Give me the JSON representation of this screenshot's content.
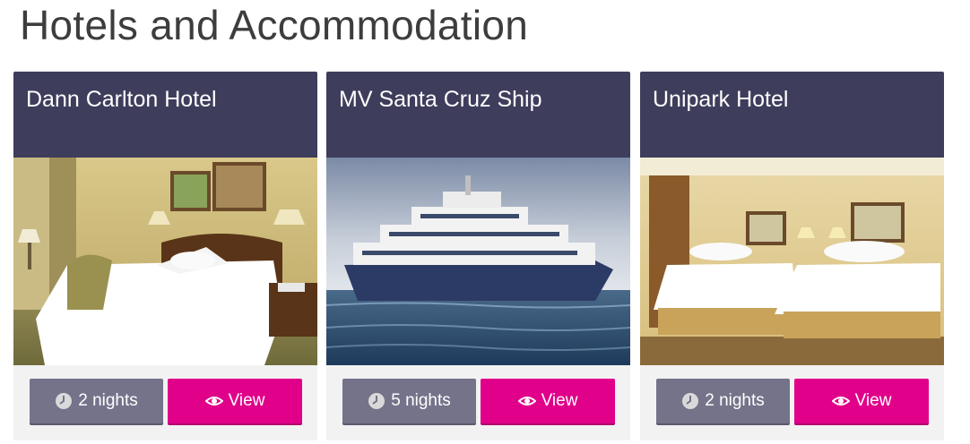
{
  "page": {
    "title": "Hotels and Accommodation"
  },
  "colors": {
    "header_bg": "#3e3d5c",
    "nights_button": "#75738a",
    "view_button": "#e1008a",
    "card_bg": "#f2f2f2"
  },
  "cards": [
    {
      "title": "Dann Carlton Hotel",
      "image": "hotel-room-king-bed",
      "nights_label": "2 nights",
      "nights_icon": "clock-icon",
      "view_label": "View",
      "view_icon": "eye-icon"
    },
    {
      "title": "MV Santa Cruz Ship",
      "image": "cruise-ship-at-sea",
      "nights_label": "5 nights",
      "nights_icon": "clock-icon",
      "view_label": "View",
      "view_icon": "eye-icon"
    },
    {
      "title": "Unipark Hotel",
      "image": "hotel-room-twin-beds",
      "nights_label": "2 nights",
      "nights_icon": "clock-icon",
      "view_label": "View",
      "view_icon": "eye-icon"
    }
  ]
}
